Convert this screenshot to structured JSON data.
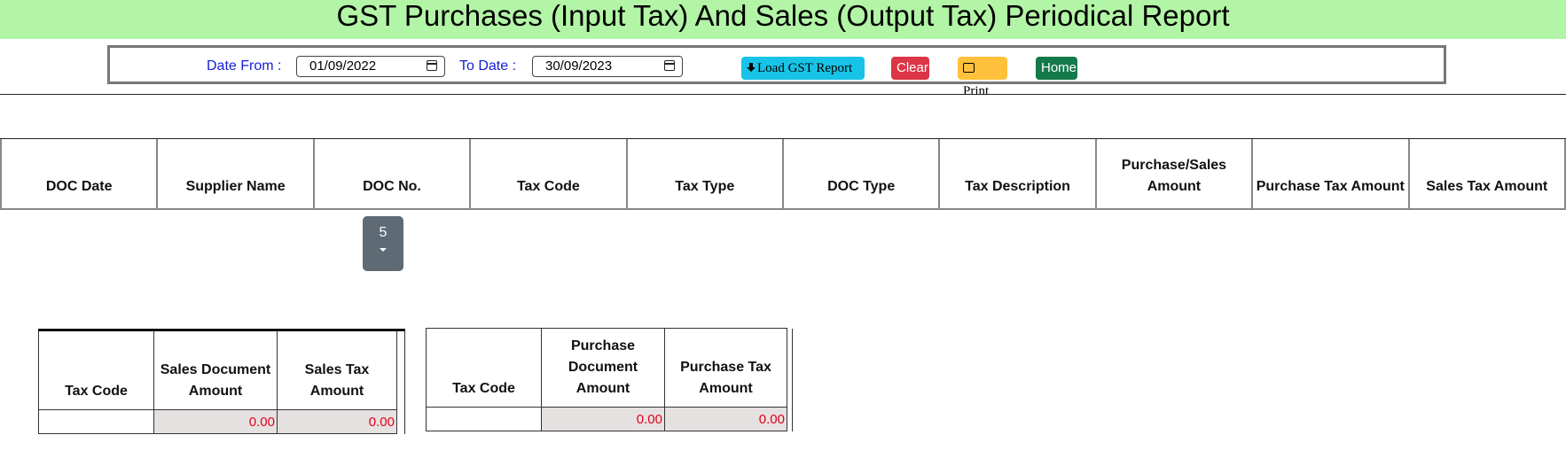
{
  "header": {
    "title": "GST Purchases (Input Tax) And Sales (Output Tax) Periodical Report"
  },
  "filters": {
    "date_from_label": "Date From :",
    "date_from_value": "01/09/2022",
    "to_date_label": "To Date :",
    "to_date_value": "30/09/2023",
    "load_label": "Load GST Report",
    "clear_label": "Clear",
    "print_label": "Print",
    "home_label": "Home"
  },
  "main_table": {
    "columns": [
      "DOC Date",
      "Supplier Name",
      "DOC No.",
      "Tax Code",
      "Tax Type",
      "DOC Type",
      "Tax Description",
      "Purchase/Sales Amount",
      "Purchase Tax Amount",
      "Sales Tax Amount"
    ]
  },
  "pager": {
    "page_size": "5"
  },
  "sales_summary": {
    "columns": [
      "Tax Code",
      "Sales Document Amount",
      "Sales Tax Amount"
    ],
    "row": {
      "tax_code": "",
      "doc_amount": "0.00",
      "tax_amount": "0.00"
    }
  },
  "purchase_summary": {
    "columns": [
      "Tax Code",
      "Purchase Document Amount",
      "Purchase Tax Amount"
    ],
    "row": {
      "tax_code": "",
      "doc_amount": "0.00",
      "tax_amount": "0.00"
    }
  },
  "colors": {
    "banner": "#b3f5a6",
    "label_blue": "#1520d4",
    "load_button": "#17c3e6",
    "clear_button": "#dc3545",
    "print_button": "#ffc13b",
    "home_button": "#157a4a",
    "amount_red": "#e0001a"
  },
  "icons": {
    "load": "download-icon",
    "print": "print-icon",
    "date": "calendar-icon",
    "pager": "chevron-down-icon"
  }
}
